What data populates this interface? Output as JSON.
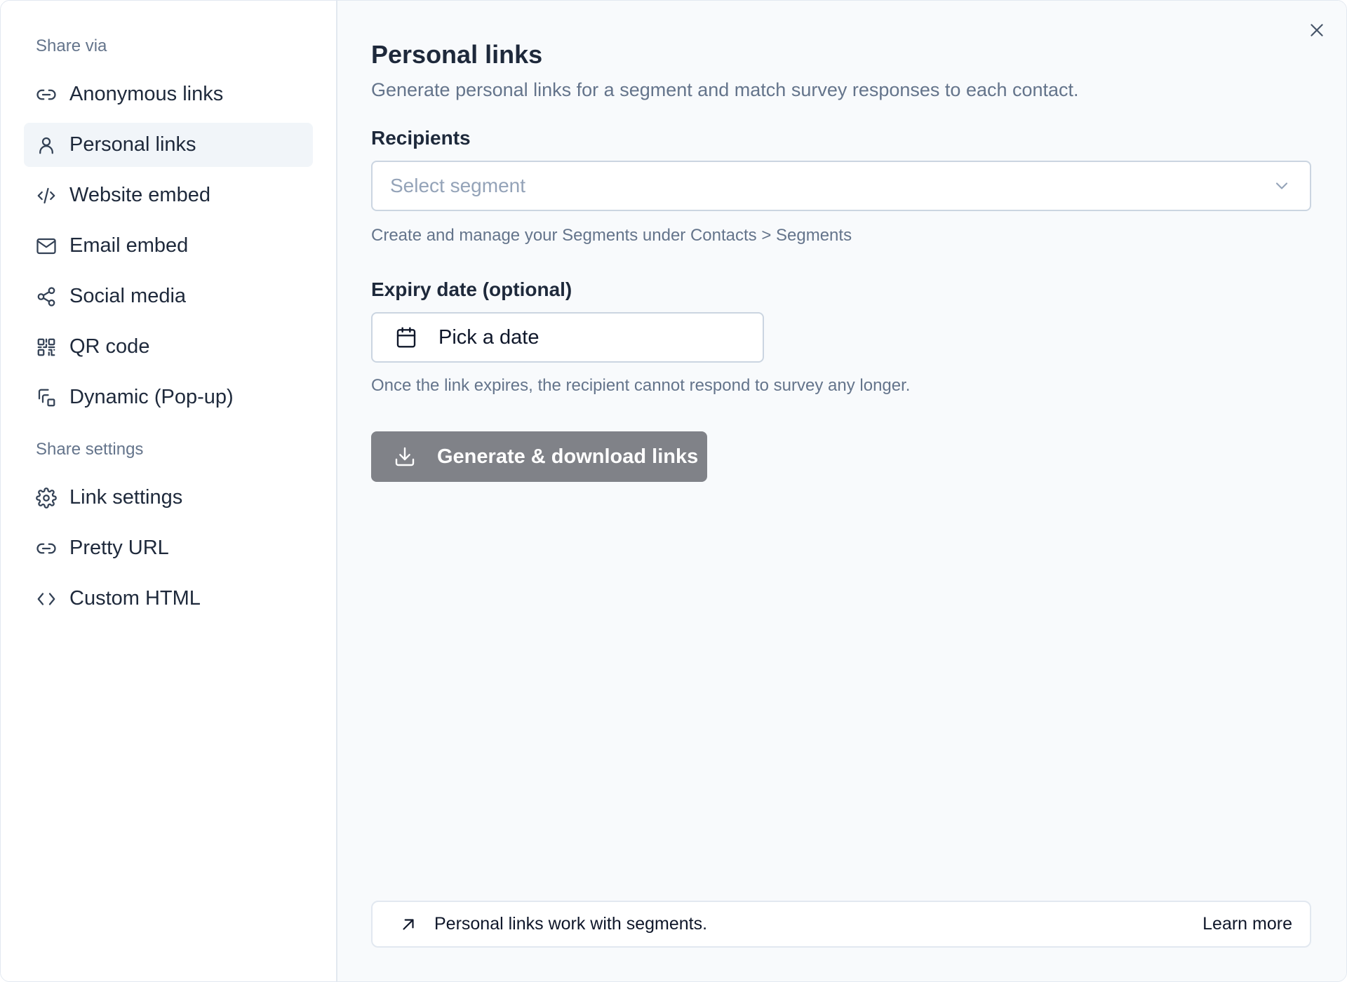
{
  "sidebar": {
    "share_via_title": "Share via",
    "share_via_items": [
      {
        "label": "Anonymous links",
        "icon": "link-icon"
      },
      {
        "label": "Personal links",
        "icon": "user-icon",
        "active": true
      },
      {
        "label": "Website embed",
        "icon": "code-slash-icon"
      },
      {
        "label": "Email embed",
        "icon": "mail-icon"
      },
      {
        "label": "Social media",
        "icon": "share-icon"
      },
      {
        "label": "QR code",
        "icon": "qr-code-icon"
      },
      {
        "label": "Dynamic (Pop-up)",
        "icon": "popup-icon"
      }
    ],
    "share_settings_title": "Share settings",
    "share_settings_items": [
      {
        "label": "Link settings",
        "icon": "gear-icon"
      },
      {
        "label": "Pretty URL",
        "icon": "link-icon"
      },
      {
        "label": "Custom HTML",
        "icon": "code-icon"
      }
    ]
  },
  "main": {
    "title": "Personal links",
    "subtitle": "Generate personal links for a segment and match survey responses to each contact.",
    "recipients_label": "Recipients",
    "segment_select_placeholder": "Select segment",
    "recipients_help": "Create and manage your Segments under Contacts > Segments",
    "expiry_label": "Expiry date (optional)",
    "date_button_label": "Pick a date",
    "expiry_help": "Once the link expires, the recipient cannot respond to survey any longer.",
    "generate_button_label": "Generate & download links",
    "footer_message": "Personal links work with segments.",
    "footer_link": "Learn more"
  },
  "colors": {
    "active_item_bg": "#f1f5f9",
    "content_bg": "#f8fafc",
    "generate_button_bg": "#808288",
    "muted_text": "#64748b"
  }
}
